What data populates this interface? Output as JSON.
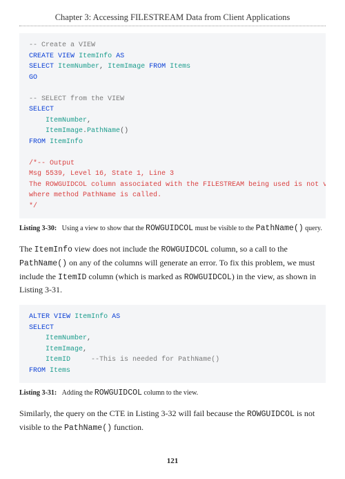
{
  "header": {
    "chapter_title": "Chapter 3: Accessing FILESTREAM Data from Client Applications"
  },
  "code1": {
    "c1": "-- Create a VIEW",
    "kw_create": "CREATE",
    "kw_view1": "VIEW",
    "id_iteminfo1": "ItemInfo",
    "kw_as1": "AS",
    "kw_select1": "SELECT",
    "id_itemnumber1": "ItemNumber",
    "punc_comma1": ",",
    "id_itemimage1": "ItemImage",
    "kw_from1": "FROM",
    "id_items1": "Items",
    "kw_go": "GO",
    "c2": "-- SELECT from the VIEW",
    "kw_select2": "SELECT",
    "id_itemnumber2": "ItemNumber",
    "punc_comma2": ",",
    "id_itemimage2": "ItemImage",
    "punc_dot": ".",
    "fn_pathname": "PathName",
    "punc_parens": "()",
    "kw_from2": "FROM",
    "id_iteminfo2": "ItemInfo",
    "out1": "/*-- Output",
    "out2": "Msg 5539, Level 16, State 1, Line 3",
    "out3": "The ROWGUIDCOL column associated with the FILESTREAM being used is not visible",
    "out4": "where method PathName is called.",
    "out5": "*/"
  },
  "caption1": {
    "label": "Listing 3-30:",
    "pre": "Using a view to show that the ",
    "mono1": "ROWGUIDCOL",
    "mid": " must be visible to the ",
    "mono2": "PathName()",
    "post": " query."
  },
  "para1": {
    "t1": "The ",
    "m1": "ItemInfo",
    "t2": " view does not include the ",
    "m2": "ROWGUIDCOL",
    "t3": " column, so a call to the ",
    "m3": "PathName()",
    "t4": " on any of the columns will generate an error. To fix this problem, we must include the ",
    "m4": "ItemID",
    "t5": " column (which is marked as ",
    "m5": "ROWGUIDCOL",
    "t6": ") in the view, as shown in Listing 3-31."
  },
  "code2": {
    "kw_alter": "ALTER",
    "kw_view2": "VIEW",
    "id_iteminfo3": "ItemInfo",
    "kw_as2": "AS",
    "kw_select3": "SELECT",
    "id_itemnumber3": "ItemNumber",
    "punc_c1": ",",
    "id_itemimage3": "ItemImage",
    "punc_c2": ",",
    "id_itemid": "ItemID",
    "comment_need": "--This is needed for PathName()",
    "kw_from3": "FROM",
    "id_items2": "Items"
  },
  "caption2": {
    "label": "Listing 3-31:",
    "pre": "Adding the ",
    "mono1": "ROWGUIDCOL",
    "post": " column to the view."
  },
  "para2": {
    "t1": "Similarly, the query on the CTE in Listing 3-32 will fail because the ",
    "m1": "ROWGUIDCOL",
    "t2": " is not visible to the ",
    "m2": "PathName()",
    "t3": " function."
  },
  "footer": {
    "page_number": "121"
  }
}
